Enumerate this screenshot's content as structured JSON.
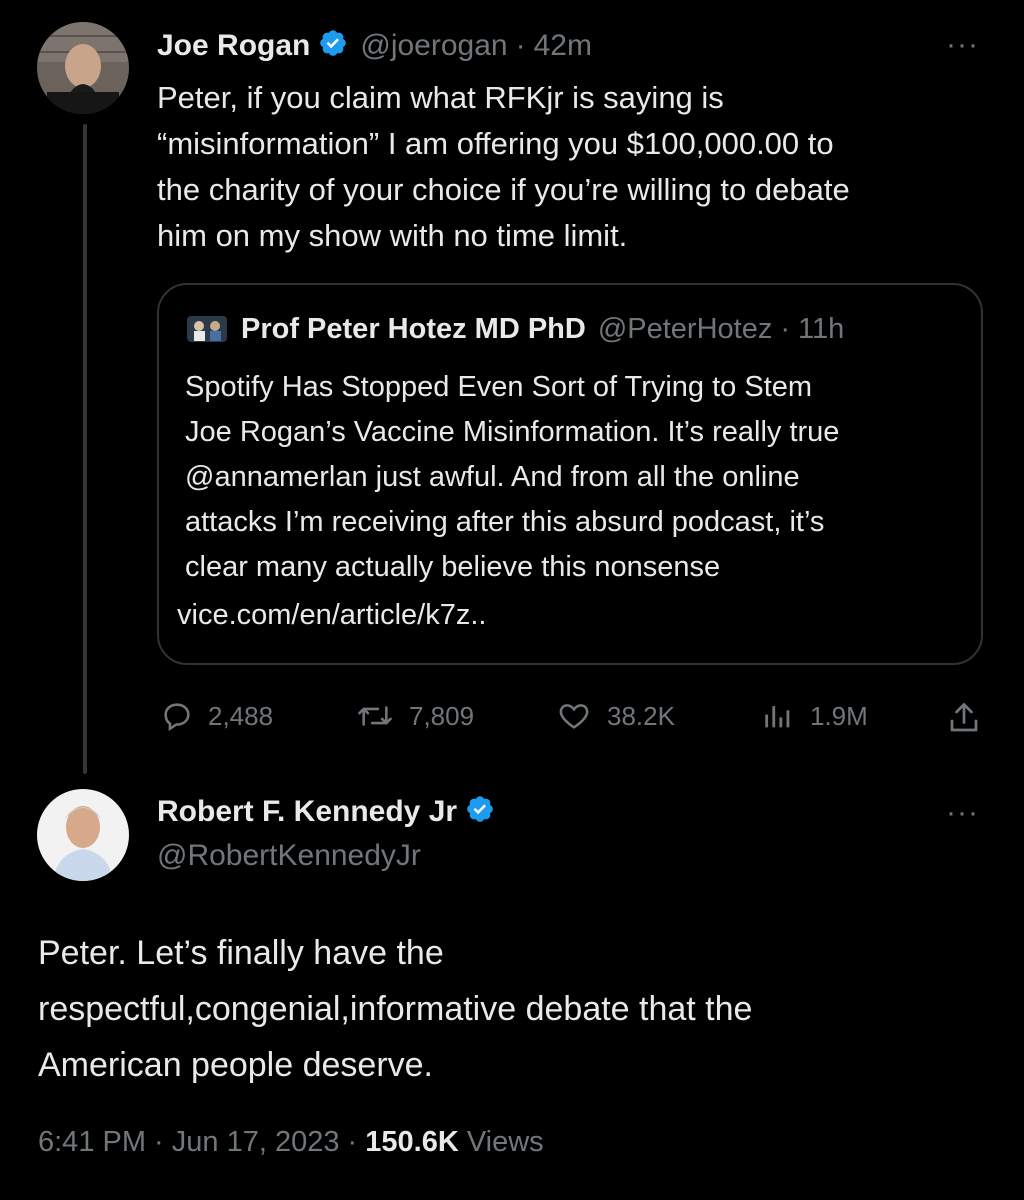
{
  "tweet": {
    "author_name": "Joe Rogan",
    "handle": "@joerogan",
    "separator": "·",
    "time": "42m",
    "more": "···",
    "text_lines": [
      "Peter, if you claim what RFKjr is saying is",
      "“misinformation” I am offering you $100,000.00 to",
      "the charity of your choice if you’re willing to debate",
      "him on my show with no time limit."
    ],
    "quote": {
      "author_name": "Prof Peter Hotez MD PhD",
      "handle": "@PeterHotez",
      "separator": "·",
      "time": "11h",
      "text_lines": [
        "Spotify Has Stopped Even Sort of Trying to Stem",
        "Joe Rogan’s Vaccine Misinformation. It’s really true",
        "@annamerlan just awful. And from all the online",
        "attacks I’m receiving after this absurd podcast, it’s",
        "clear many actually believe this nonsense"
      ],
      "link": "vice.com/en/article/k7z.."
    },
    "actions": {
      "replies": "2,488",
      "retweets": "7,809",
      "likes": "38.2K",
      "views": "1.9M"
    }
  },
  "reply": {
    "author_name": "Robert F. Kennedy Jr",
    "handle": "@RobertKennedyJr",
    "more": "···",
    "text_lines": [
      "Peter. Let’s finally have the",
      "respectful,congenial,informative debate that the",
      "American people deserve."
    ],
    "timestamp": "6:41 PM · Jun 17, 2023 ·",
    "views_count": "150.6K",
    "views_label": "Views"
  },
  "colors": {
    "background": "#000000",
    "text": "#e7e9ea",
    "secondary": "#71767b",
    "verified": "#1d9bf0",
    "border": "#2f3336"
  }
}
